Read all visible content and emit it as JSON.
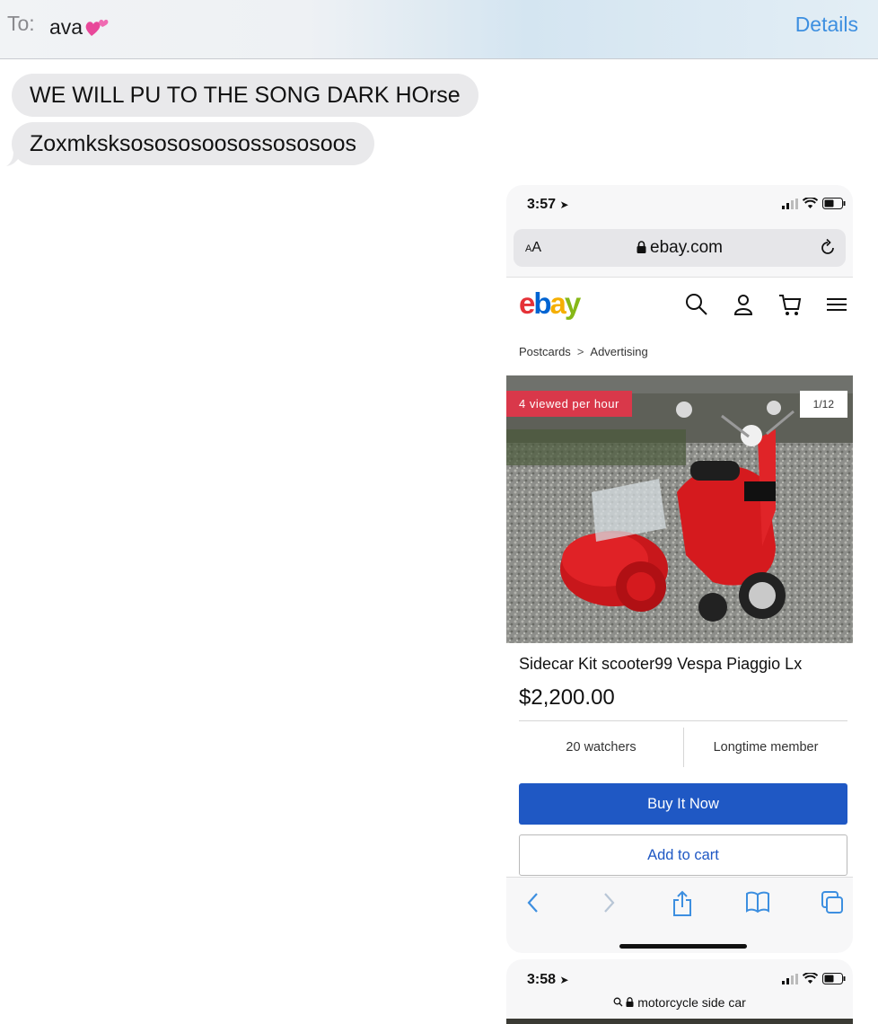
{
  "header": {
    "to_label": "To:",
    "recipient": "ava",
    "details": "Details"
  },
  "messages": [
    {
      "text": "WE WILL PU TO THE SONG DARK HOrse"
    },
    {
      "text": "Zoxmksksosososoosossososoos"
    }
  ],
  "screenshot1": {
    "time": "3:57",
    "aa_small": "A",
    "aa_large": "A",
    "url": "ebay.com",
    "breadcrumb": [
      "Postcards",
      "Advertising"
    ],
    "breadcrumb_sep": ">",
    "badge": "4 viewed per hour",
    "image_counter": "1/12",
    "item_title": "Sidecar Kit scooter99 Vespa Piaggio Lx",
    "price": "$2,200.00",
    "watchers": "20 watchers",
    "seller_badge": "Longtime member",
    "buy_button": "Buy It Now",
    "cart_button": "Add to cart",
    "logo": {
      "e": "e",
      "b": "b",
      "a": "a",
      "y": "y"
    }
  },
  "screenshot2": {
    "time": "3:58",
    "search": "motorcycle side car"
  },
  "colors": {
    "link_blue": "#3d8fe0",
    "ebay_blue": "#1f58c4",
    "badge_red": "#d9384a",
    "bubble_gray": "#e9e9eb"
  }
}
